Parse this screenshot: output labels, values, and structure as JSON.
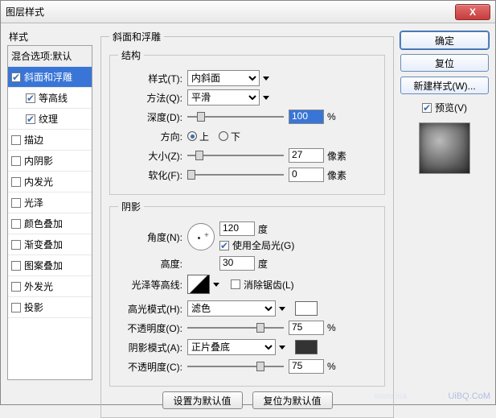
{
  "window": {
    "title": "图层样式"
  },
  "close_icon": "X",
  "sidebar": {
    "header": "样式",
    "blend_label": "混合选项:默认",
    "items": [
      {
        "label": "斜面和浮雕",
        "checked": true,
        "selected": true
      },
      {
        "label": "等高线",
        "checked": true,
        "indent": true
      },
      {
        "label": "纹理",
        "checked": true,
        "indent": true
      },
      {
        "label": "描边",
        "checked": false
      },
      {
        "label": "内阴影",
        "checked": false
      },
      {
        "label": "内发光",
        "checked": false
      },
      {
        "label": "光泽",
        "checked": false
      },
      {
        "label": "颜色叠加",
        "checked": false
      },
      {
        "label": "渐变叠加",
        "checked": false
      },
      {
        "label": "图案叠加",
        "checked": false
      },
      {
        "label": "外发光",
        "checked": false
      },
      {
        "label": "投影",
        "checked": false
      }
    ]
  },
  "panel": {
    "title": "斜面和浮雕",
    "structure": {
      "legend": "结构",
      "style_label": "样式(T):",
      "style_value": "内斜面",
      "technique_label": "方法(Q):",
      "technique_value": "平滑",
      "depth_label": "深度(D):",
      "depth_value": "100",
      "depth_unit": "%",
      "direction_label": "方向:",
      "up_label": "上",
      "down_label": "下",
      "size_label": "大小(Z):",
      "size_value": "27",
      "size_unit": "像素",
      "soften_label": "软化(F):",
      "soften_value": "0",
      "soften_unit": "像素"
    },
    "shading": {
      "legend": "阴影",
      "angle_label": "角度(N):",
      "angle_value": "120",
      "angle_unit": "度",
      "global_label": "使用全局光(G)",
      "altitude_label": "高度:",
      "altitude_value": "30",
      "altitude_unit": "度",
      "gloss_label": "光泽等高线:",
      "antialias_label": "消除锯齿(L)",
      "highlight_mode_label": "高光模式(H):",
      "highlight_mode_value": "滤色",
      "highlight_opacity_label": "不透明度(O):",
      "highlight_opacity_value": "75",
      "highlight_opacity_unit": "%",
      "shadow_mode_label": "阴影模式(A):",
      "shadow_mode_value": "正片叠底",
      "shadow_opacity_label": "不透明度(C):",
      "shadow_opacity_value": "75",
      "shadow_opacity_unit": "%"
    },
    "buttons": {
      "default": "设置为默认值",
      "reset": "复位为默认值"
    }
  },
  "right": {
    "ok": "确定",
    "cancel": "复位",
    "new_style": "新建样式(W)...",
    "preview": "预览(V)"
  },
  "watermark": "UiBQ.CoM",
  "watermark2": "www.isa"
}
